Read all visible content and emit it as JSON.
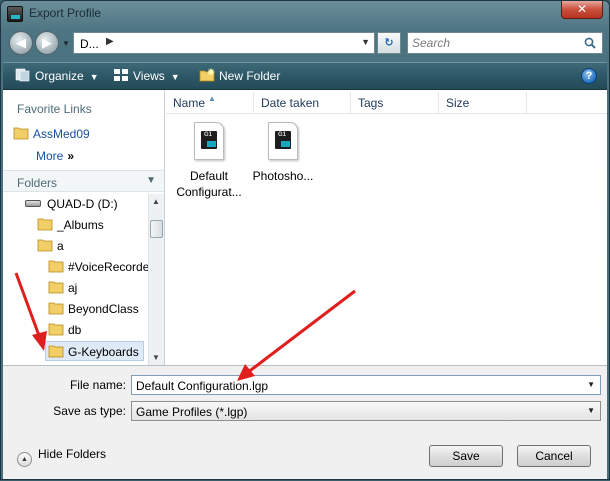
{
  "window": {
    "title": "Export Profile",
    "close_glyph": "✕"
  },
  "navbar": {
    "address_text": "D...",
    "address_chevron": "▶",
    "search_placeholder": "Search"
  },
  "toolbar": {
    "organize_label": "Organize",
    "views_label": "Views",
    "new_folder_label": "New Folder",
    "help_glyph": "?"
  },
  "favorites": {
    "title": "Favorite Links",
    "items": [
      {
        "label": "AssMed09"
      }
    ],
    "more_label": "More",
    "more_arrows": "»"
  },
  "folders": {
    "title": "Folders",
    "chevron": "⌄",
    "tree": [
      {
        "label": "QUAD-D (D:)",
        "icon": "drive-icon"
      },
      {
        "label": "_Albums",
        "icon": "folder-icon"
      },
      {
        "label": "a",
        "icon": "folder-icon"
      },
      {
        "label": "#VoiceRecorder",
        "icon": "folder-icon"
      },
      {
        "label": "aj",
        "icon": "folder-icon"
      },
      {
        "label": "BeyondClass",
        "icon": "folder-icon"
      },
      {
        "label": "db",
        "icon": "folder-icon"
      },
      {
        "label": "G-Keyboards",
        "icon": "folder-icon"
      }
    ]
  },
  "file_list": {
    "columns": [
      "Name",
      "Date taken",
      "Tags",
      "Size"
    ],
    "sort_indicator": "▲",
    "files": [
      {
        "label_line1": "Default",
        "label_line2": "Configurat...",
        "tag": "G1"
      },
      {
        "label_line1": "Photosho...",
        "label_line2": "",
        "tag": "G1"
      }
    ]
  },
  "form": {
    "file_name_label": "File name:",
    "file_name_value": "Default Configuration.lgp",
    "save_type_label": "Save as type:",
    "save_type_value": "Game Profiles (*.lgp)"
  },
  "footer": {
    "hide_folders_label": "Hide Folders",
    "save_label": "Save",
    "cancel_label": "Cancel"
  },
  "colors": {
    "frame": "#4a7280",
    "toolbar": "#2d5766",
    "link": "#1a4fa3",
    "annotation_arrow": "#e01e1e"
  }
}
